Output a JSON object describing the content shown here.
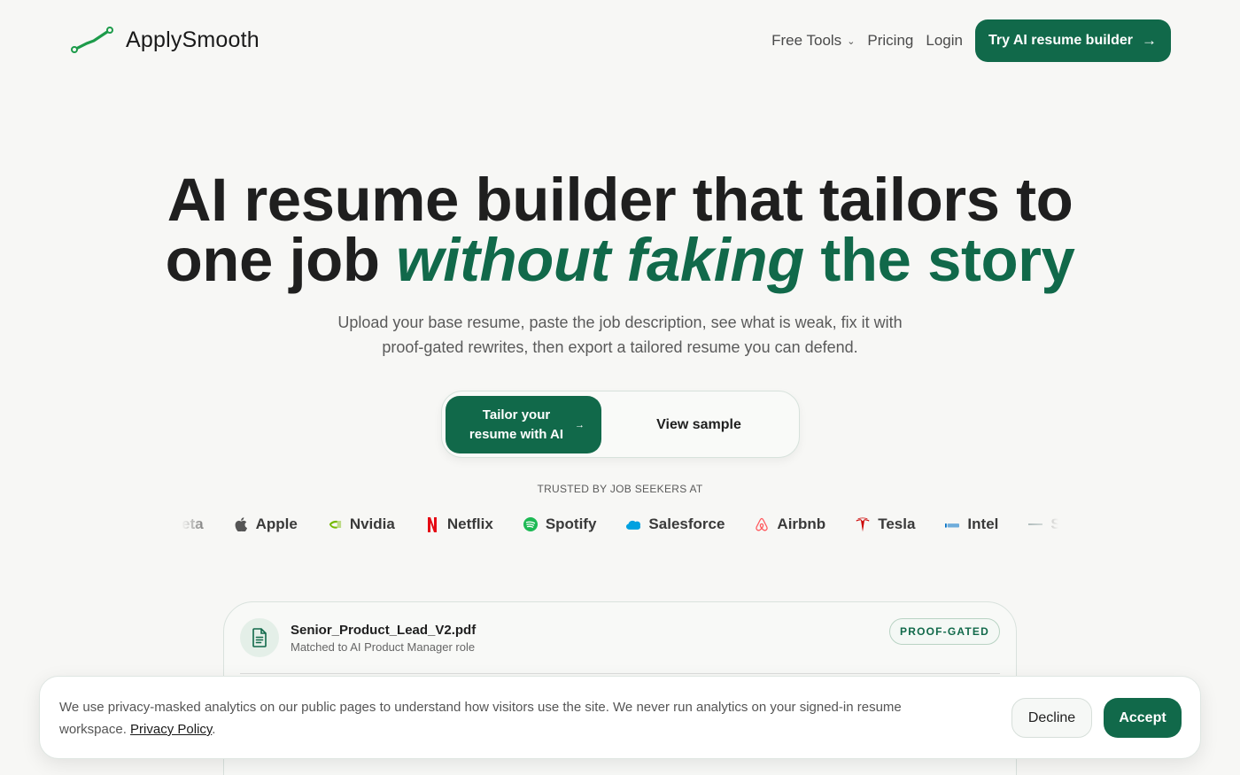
{
  "nav": {
    "brand": "ApplySmooth",
    "links": [
      "Free Tools",
      "Pricing",
      "Login"
    ],
    "cta": "Try AI resume builder",
    "icons": {
      "logo": "trend-line-logo-icon",
      "dropdown": "chevron-down-icon",
      "cta_arrow": "arrow-right-icon"
    }
  },
  "hero": {
    "title_line1": "AI resume builder that tailors to",
    "title_line2_plain": "one job",
    "title_line2_italic": "without faking",
    "title_line2_end": "the story",
    "subtitle": "Upload your base resume, paste the job description, see what is weak, fix it with proof-gated rewrites, then export a tailored resume you can defend.",
    "cta_primary": "Tailor your resume with AI",
    "cta_secondary": "View sample"
  },
  "trusted": {
    "label": "TRUSTED BY JOB SEEKERS AT",
    "brands": [
      "eta",
      "Apple",
      "Nvidia",
      "Netflix",
      "Spotify",
      "Salesforce",
      "Airbnb",
      "Tesla",
      "Intel",
      "Sa"
    ]
  },
  "preview": {
    "file_name": "Senior_Product_Lead_V2.pdf",
    "file_sub": "Matched to AI Product Manager role",
    "badge": "PROOF-GATED"
  },
  "cookie": {
    "text": "We use privacy-masked analytics on our public pages to understand how visitors use the site. We never run analytics on your signed-in resume workspace.",
    "link": "Privacy Policy",
    "end": ".",
    "decline": "Decline",
    "accept": "Accept"
  },
  "colors": {
    "accent": "#11694a",
    "background": "#f7f7f5",
    "logo_green": "#1d9b4a"
  }
}
